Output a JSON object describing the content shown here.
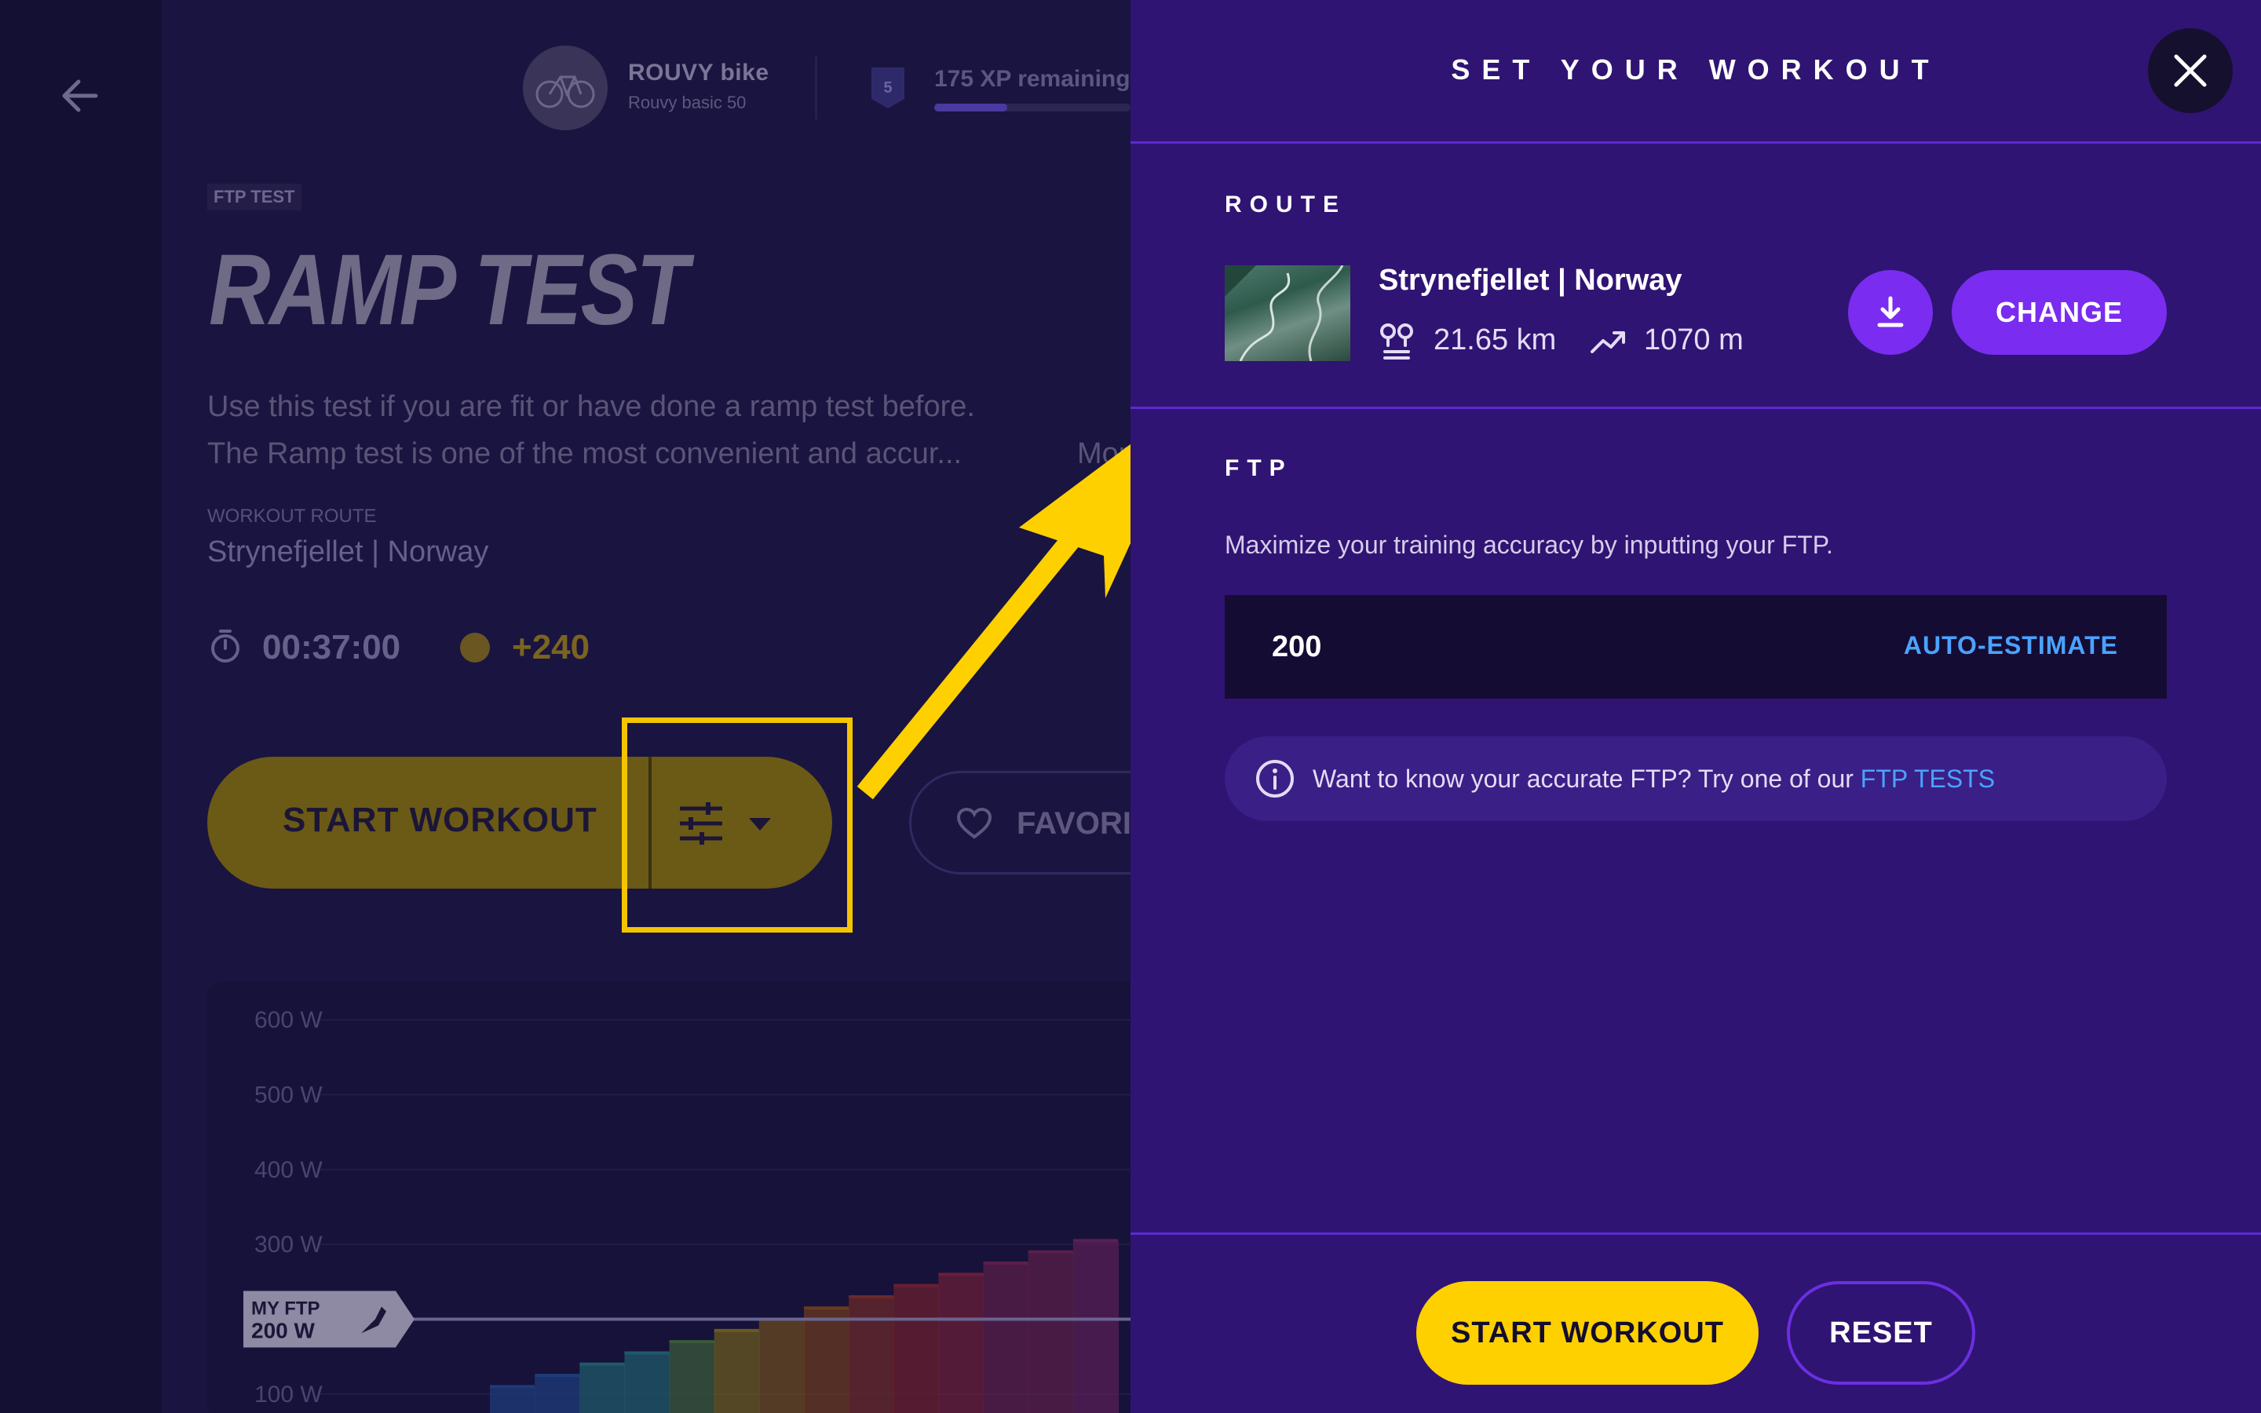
{
  "background": {
    "bike": {
      "name": "ROUVY bike",
      "subtitle": "Rouvy basic 50"
    },
    "level": {
      "number": "5",
      "xp_text": "175 XP remaining",
      "progress": 0.37
    },
    "workout": {
      "tag": "FTP TEST",
      "title": "RAMP TEST",
      "description_line1": "Use this test if you are fit or have done a ramp test before.",
      "description_line2": "The Ramp test is one of the most convenient and accur...",
      "more_link": "More",
      "route_label": "WORKOUT ROUTE",
      "route_value": "Strynefjellet | Norway",
      "duration": "00:37:00",
      "xp_reward": "+240"
    },
    "buttons": {
      "start_workout": "START WORKOUT",
      "favorite": "FAVORITE"
    },
    "chart": {
      "ftp_tag_line1": "MY FTP",
      "ftp_tag_line2": "200 W"
    }
  },
  "chart_data": {
    "type": "bar",
    "title": "",
    "xlabel": "",
    "ylabel": "",
    "y_tick_labels": [
      "600 W",
      "500 W",
      "400 W",
      "300 W",
      "100 W"
    ],
    "ylim": [
      80,
      620
    ],
    "ftp_line": 200,
    "values": [
      110,
      125,
      140,
      155,
      170,
      185,
      200,
      215,
      230,
      245,
      260,
      275,
      290,
      305
    ],
    "colors": [
      "#1f3b7a",
      "#1f3b7a",
      "#1f5a6a",
      "#1f5a6a",
      "#3a5a3a",
      "#6a5a1f",
      "#6a4a1f",
      "#6a3a1f",
      "#6a2a2a",
      "#6a1f2f",
      "#6a1f3a",
      "#5a1f4a",
      "#5a1f4a",
      "#5a1f55"
    ]
  },
  "panel": {
    "title": "SET YOUR WORKOUT",
    "route_section": "ROUTE",
    "route": {
      "name": "Strynefjellet | Norway",
      "distance": "21.65 km",
      "elevation": "1070 m",
      "change_label": "CHANGE"
    },
    "ftp_section": "FTP",
    "ftp_description": "Maximize your training accuracy by inputting your FTP.",
    "ftp_value": "200",
    "auto_estimate": "AUTO-ESTIMATE",
    "info_text": "Want to know your accurate FTP? Try one of our",
    "info_link": "FTP TESTS",
    "start_label": "START WORKOUT",
    "reset_label": "RESET"
  },
  "colors": {
    "accent_purple": "#7a2cf0",
    "accent_yellow": "#ffd000",
    "link_blue": "#4aa3ff",
    "panel_bg": "#2f1473"
  }
}
